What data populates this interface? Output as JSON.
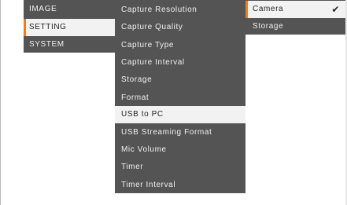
{
  "main_menu": {
    "items": [
      {
        "label": "IMAGE"
      },
      {
        "label": "SETTING"
      },
      {
        "label": "SYSTEM"
      }
    ]
  },
  "setting_menu": {
    "items": [
      {
        "label": "Capture Resolution"
      },
      {
        "label": "Capture Quality"
      },
      {
        "label": "Capture Type"
      },
      {
        "label": "Capture Interval"
      },
      {
        "label": "Storage"
      },
      {
        "label": "Format"
      },
      {
        "label": "USB to PC"
      },
      {
        "label": "USB Streaming Format"
      },
      {
        "label": "Mic Volume"
      },
      {
        "label": "Timer"
      },
      {
        "label": "Timer Interval"
      }
    ]
  },
  "capture_menu": {
    "items": [
      {
        "label": "Camera",
        "check_icon": "✔"
      },
      {
        "label": "Storage"
      }
    ]
  },
  "colors": {
    "menu_background": "#545454",
    "selected_background": "#f2f2f2",
    "accent": "#f07d1a",
    "text_light": "#f1f1f1",
    "text_dark": "#1f1f1f"
  },
  "icons": {
    "checkmark": "check-icon"
  }
}
